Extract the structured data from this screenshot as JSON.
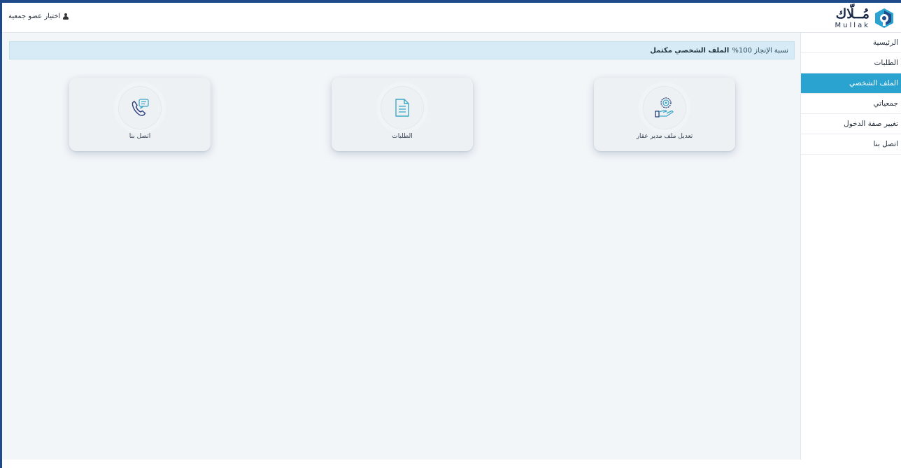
{
  "header": {
    "user_link": "اختيار عضو جمعية",
    "logo_ar": "مُــلّاك",
    "logo_en": "Mullak"
  },
  "sidebar": {
    "items": [
      {
        "label": "الرئيسية",
        "active": false
      },
      {
        "label": "الطلبات",
        "active": false
      },
      {
        "label": "الملف الشخصي",
        "active": true
      },
      {
        "label": "جمعياتي",
        "active": false
      },
      {
        "label": "تغيير صفة الدخول",
        "active": false
      },
      {
        "label": "اتصل بنا",
        "active": false
      }
    ]
  },
  "alert": {
    "prefix": "نسبة الإنجاز 100%",
    "bold": "الملف الشخصي مكتمل"
  },
  "cards": [
    {
      "label": "تعديل ملف مدير عقار",
      "icon": "property-manager-icon"
    },
    {
      "label": "الطلبات",
      "icon": "document-icon"
    },
    {
      "label": "اتصل بنا",
      "icon": "phone-chat-icon"
    }
  ],
  "colors": {
    "accent": "#2aa3d1",
    "frame": "#1f4a8a",
    "alert_bg": "#d6ebf5",
    "icon_navy": "#2a3d7a",
    "icon_teal": "#3fa8c7"
  }
}
